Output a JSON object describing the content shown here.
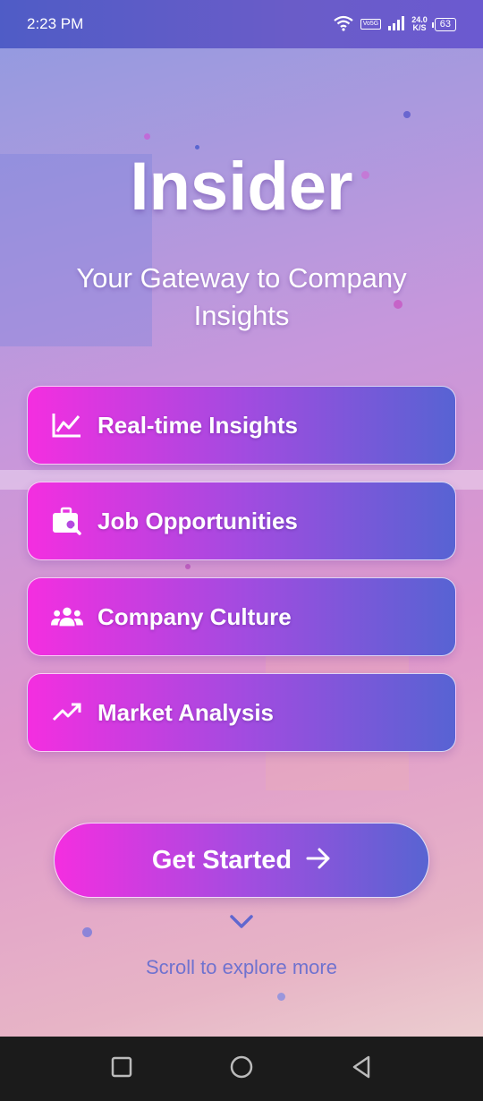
{
  "status_bar": {
    "time": "2:23 PM",
    "volte": "Vo5G",
    "speed_value": "24.0",
    "speed_unit": "K/S",
    "battery": "63"
  },
  "hero": {
    "title": "Insider",
    "subtitle": "Your Gateway to Company Insights"
  },
  "features": [
    {
      "label": "Real-time Insights",
      "icon": "line-chart-icon"
    },
    {
      "label": "Job Opportunities",
      "icon": "briefcase-search-icon"
    },
    {
      "label": "Company Culture",
      "icon": "people-group-icon"
    },
    {
      "label": "Market Analysis",
      "icon": "trending-up-icon"
    }
  ],
  "cta": {
    "label": "Get Started",
    "icon": "arrow-right-icon"
  },
  "scroll_hint": "Scroll to explore more",
  "nav": [
    "recent-apps-icon",
    "home-icon",
    "back-icon"
  ],
  "colors": {
    "accent_pink": "#f42ee0",
    "accent_blue": "#5864d2",
    "status_bar": "#4f5cc6",
    "scroll_text": "#6f72cf"
  }
}
